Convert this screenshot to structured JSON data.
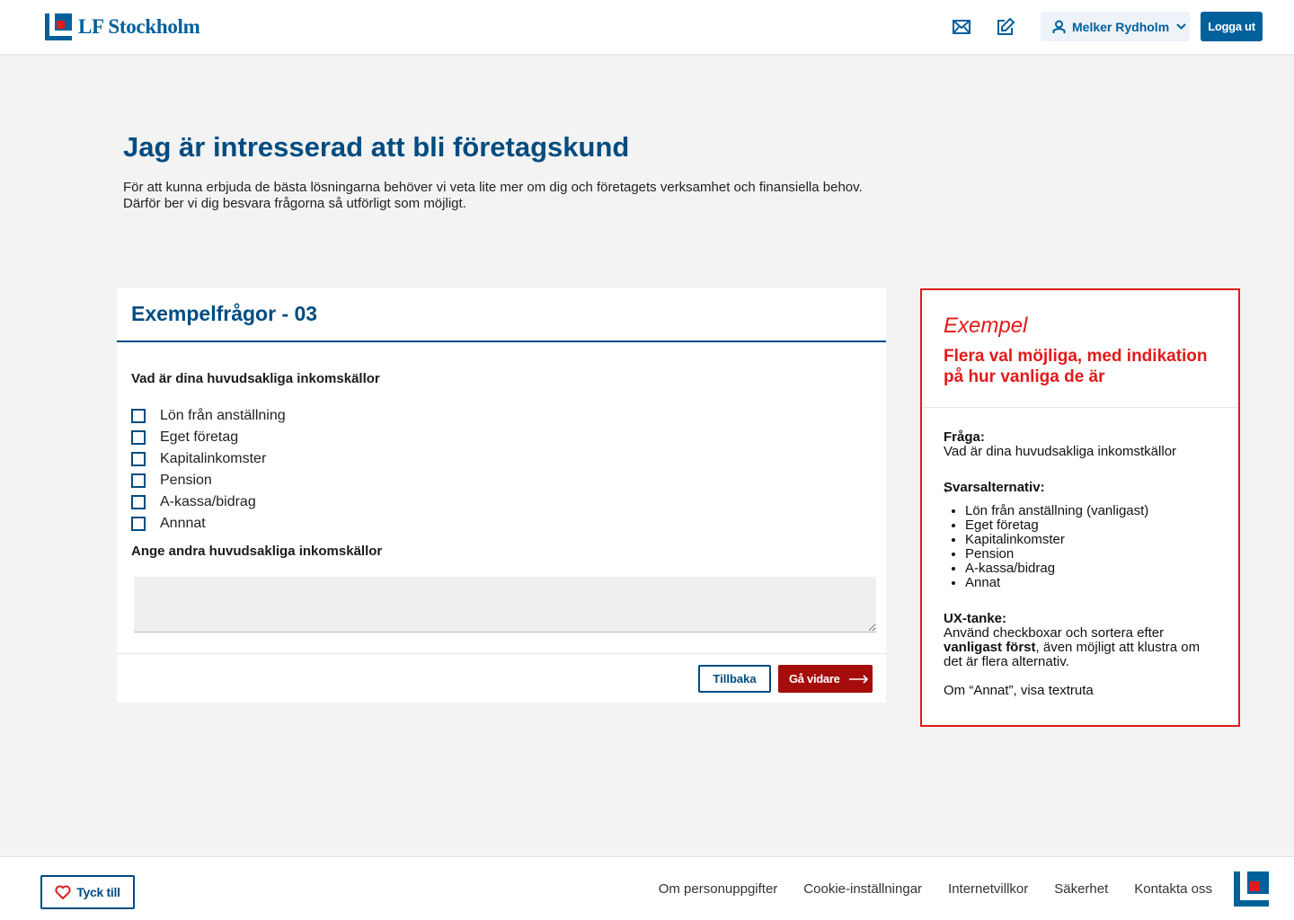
{
  "brand": {
    "name": "LF Stockholm",
    "primary_color": "#00609c",
    "dark_blue": "#004c80",
    "accent_red": "#a50d0d",
    "example_red": "#e21a1a"
  },
  "header": {
    "mail_icon": "mail-icon",
    "edit_icon": "edit-icon",
    "user_name": "Melker Rydholm",
    "logout_label": "Logga ut"
  },
  "page": {
    "title": "Jag är intresserad att bli företagskund",
    "intro": "För att kunna erbjuda de bästa lösningarna behöver vi veta lite mer om dig och företagets verksamhet och finansiella behov. Därför ber vi dig besvara frågorna så utförligt som möjligt."
  },
  "form": {
    "title": "Exempelfrågor - 03",
    "question": "Vad är dina huvudsakliga inkomskällor",
    "options": [
      {
        "label": "Lön från anställning",
        "checked": false
      },
      {
        "label": "Eget företag",
        "checked": false
      },
      {
        "label": "Kapitalinkomster",
        "checked": false
      },
      {
        "label": "Pension",
        "checked": false
      },
      {
        "label": "A-kassa/bidrag",
        "checked": false
      },
      {
        "label": "Annnat",
        "checked": false
      }
    ],
    "other_label": "Ange andra huvudsakliga inkomskällor",
    "other_value": "",
    "back_label": "Tillbaka",
    "next_label": "Gå vidare"
  },
  "example": {
    "heading": "Exempel",
    "subheading": "Flera val möjliga, med indikation på hur vanliga de är",
    "question_label": "Fråga:",
    "question_text": "Vad är dina huvudsakliga inkomstkällor",
    "answers_label": "Svarsalternativ:",
    "stray_char": "`",
    "answers": [
      "Lön från anställning (vanligast)",
      "Eget företag",
      "Kapitalinkomster",
      "Pension",
      "A-kassa/bidrag",
      "Annat"
    ],
    "ux_label": "UX-tanke:",
    "ux_text_1": "Använd checkboxar och sortera efter ",
    "ux_text_bold": "vanligast först",
    "ux_text_2": ", även möjligt att klustra om det är flera alternativ.",
    "ux_note": "Om “Annat”, visa textruta"
  },
  "footer": {
    "feedback_label": "Tyck till",
    "links": [
      "Om personuppgifter",
      "Cookie-inställningar",
      "Internetvillkor",
      "Säkerhet",
      "Kontakta oss"
    ]
  }
}
